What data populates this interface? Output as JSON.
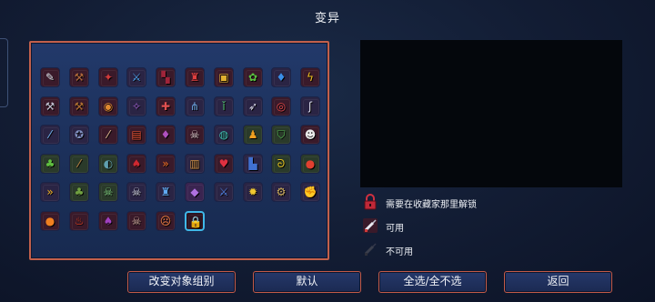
{
  "header": {
    "title": "变异"
  },
  "mutations": {
    "rows": [
      [
        {
          "icon": "syringe-icon",
          "glyph": "✎",
          "fg": "#e6e6f0",
          "bg": "#3a1a2a"
        },
        {
          "icon": "pickaxe-icon",
          "glyph": "⚒",
          "fg": "#b06a3a",
          "bg": "#3a1a2a"
        },
        {
          "icon": "red-dagger-icon",
          "glyph": "✦",
          "fg": "#d03a3a",
          "bg": "#3a1a2a"
        },
        {
          "icon": "blue-swords-icon",
          "glyph": "⚔",
          "fg": "#4aa0e8",
          "bg": "#2a2444"
        },
        {
          "icon": "crimson-rune-icon",
          "glyph": "▚",
          "fg": "#a0243a",
          "bg": "#3a1a2a"
        },
        {
          "icon": "red-potion-icon",
          "glyph": "♜",
          "fg": "#e04040",
          "bg": "#3a1a2a"
        },
        {
          "icon": "treasure-chest-icon",
          "glyph": "▣",
          "fg": "#e0b030",
          "bg": "#3a1a2a"
        },
        {
          "icon": "green-leaf-icon",
          "glyph": "✿",
          "fg": "#5ac040",
          "bg": "#3a1a2a"
        },
        {
          "icon": "blue-bottle-icon",
          "glyph": "♦",
          "fg": "#3a8ee8",
          "bg": "#2a2444"
        },
        {
          "icon": "lightning-icon",
          "glyph": "ϟ",
          "fg": "#f0c020",
          "bg": "#3a1a2a"
        }
      ],
      [
        {
          "icon": "axe-icon",
          "glyph": "⚒",
          "fg": "#c0c0d0",
          "bg": "#3a1a2a"
        },
        {
          "icon": "hammer-icon",
          "glyph": "⚒",
          "fg": "#b07030",
          "bg": "#3a1a2a"
        },
        {
          "icon": "ring-icon",
          "glyph": "◉",
          "fg": "#e08a30",
          "bg": "#3a1a2a"
        },
        {
          "icon": "purple-blade-icon",
          "glyph": "✧",
          "fg": "#a060d0",
          "bg": "#2a2444"
        },
        {
          "icon": "crossed-blades-icon",
          "glyph": "✚",
          "fg": "#e05050",
          "bg": "#3a1a2a"
        },
        {
          "icon": "blue-crossbow-icon",
          "glyph": "⋔",
          "fg": "#70a8e8",
          "bg": "#2a2444"
        },
        {
          "icon": "green-vial-icon",
          "glyph": "ǐ",
          "fg": "#50c070",
          "bg": "#2a2444"
        },
        {
          "icon": "bow-icon",
          "glyph": "➶",
          "fg": "#d8d8e8",
          "bg": "#2a2444"
        },
        {
          "icon": "red-target-icon",
          "glyph": "◎",
          "fg": "#e04848",
          "bg": "#3a1a2a"
        },
        {
          "icon": "hook-icon",
          "glyph": "ʃ",
          "fg": "#e0e0f0",
          "bg": "#2a2444"
        }
      ],
      [
        {
          "icon": "lance-icon",
          "glyph": "⁄",
          "fg": "#70b8f0",
          "bg": "#2a2444"
        },
        {
          "icon": "grenade-icon",
          "glyph": "✪",
          "fg": "#8090c0",
          "bg": "#2a2444"
        },
        {
          "icon": "flail-icon",
          "glyph": "⁄",
          "fg": "#e0c090",
          "bg": "#3a1a2a"
        },
        {
          "icon": "red-chest-icon",
          "glyph": "▤",
          "fg": "#e05030",
          "bg": "#3a1a2a"
        },
        {
          "icon": "violet-gem-icon",
          "glyph": "♦",
          "fg": "#b050c0",
          "bg": "#3a1a2a"
        },
        {
          "icon": "skull-cross-icon",
          "glyph": "☠",
          "fg": "#e0d0d0",
          "bg": "#3a1a2a"
        },
        {
          "icon": "teal-orb-icon",
          "glyph": "◍",
          "fg": "#40c0b0",
          "bg": "#2a2444"
        },
        {
          "icon": "gold-bell-icon",
          "glyph": "♟",
          "fg": "#f0a020",
          "bg": "#2a3a2a"
        },
        {
          "icon": "green-shield-icon",
          "glyph": "⛉",
          "fg": "#50b050",
          "bg": "#2a3a2a"
        },
        {
          "icon": "grin-mask-icon",
          "glyph": "☻",
          "fg": "#e8e8e8",
          "bg": "#3a1a2a"
        }
      ],
      [
        {
          "icon": "acid-flask-icon",
          "glyph": "♣",
          "fg": "#60c040",
          "bg": "#2a3a2a"
        },
        {
          "icon": "spear-icon",
          "glyph": "⁄",
          "fg": "#c08040",
          "bg": "#2a3a2a"
        },
        {
          "icon": "shell-icon",
          "glyph": "◐",
          "fg": "#60a0b0",
          "bg": "#2a3a2a"
        },
        {
          "icon": "blood-drop-icon",
          "glyph": "♠",
          "fg": "#d02830",
          "bg": "#3a1a2a"
        },
        {
          "icon": "dash-arrows-icon",
          "glyph": "»",
          "fg": "#f07020",
          "bg": "#3a1a2a"
        },
        {
          "icon": "barrel-icon",
          "glyph": "▥",
          "fg": "#d09040",
          "bg": "#2a2444"
        },
        {
          "icon": "heart-arrow-icon",
          "glyph": "♥",
          "fg": "#e03040",
          "bg": "#3a1a2a"
        },
        {
          "icon": "blue-gauntlet-icon",
          "glyph": "▙",
          "fg": "#4070d0",
          "bg": "#2a2444"
        },
        {
          "icon": "coil-icon",
          "glyph": "ᘐ",
          "fg": "#e0c020",
          "bg": "#2a3a2a"
        },
        {
          "icon": "strawberry-icon",
          "glyph": "●",
          "fg": "#e04030",
          "bg": "#2a3a2a"
        }
      ],
      [
        {
          "icon": "double-arrow-icon",
          "glyph": "»",
          "fg": "#f0b020",
          "bg": "#2a2444"
        },
        {
          "icon": "green-claw-icon",
          "glyph": "♣",
          "fg": "#70a040",
          "bg": "#2a3a2a"
        },
        {
          "icon": "green-skull-icon",
          "glyph": "☠",
          "fg": "#80d080",
          "bg": "#2a3a2a"
        },
        {
          "icon": "bone-skull-icon",
          "glyph": "☠",
          "fg": "#d8dce8",
          "bg": "#2a2444"
        },
        {
          "icon": "blue-castle-icon",
          "glyph": "♜",
          "fg": "#60a8f0",
          "bg": "#2a2444"
        },
        {
          "icon": "purple-crystal-icon",
          "glyph": "◆",
          "fg": "#b070e0",
          "bg": "#3a2450"
        },
        {
          "icon": "blue-sword-icon",
          "glyph": "⚔",
          "fg": "#5080e0",
          "bg": "#2a2444"
        },
        {
          "icon": "sun-flare-icon",
          "glyph": "✹",
          "fg": "#f0c830",
          "bg": "#2a2444"
        },
        {
          "icon": "gear-icon",
          "glyph": "⚙",
          "fg": "#d0b060",
          "bg": "#2a2444"
        },
        {
          "icon": "golden-fist-icon",
          "glyph": "✊",
          "fg": "#f0c020",
          "bg": "#2a2444"
        }
      ],
      [
        {
          "icon": "fire-orb-icon",
          "glyph": "●",
          "fg": "#f08020",
          "bg": "#3a1a2a"
        },
        {
          "icon": "flame-blade-icon",
          "glyph": "♨",
          "fg": "#e04020",
          "bg": "#3a1a2a"
        },
        {
          "icon": "purple-potion-icon",
          "glyph": "♠",
          "fg": "#a040c0",
          "bg": "#3a1a2a"
        },
        {
          "icon": "bronze-skull-icon",
          "glyph": "☠",
          "fg": "#d0b0a0",
          "bg": "#3a1a2a"
        },
        {
          "icon": "orange-mask-icon",
          "glyph": "☹",
          "fg": "#f08040",
          "bg": "#3a1a2a"
        },
        {
          "icon": "padlock-icon",
          "glyph": "🔒",
          "fg": "#e03040",
          "bg": "#2e1420",
          "selected": true
        }
      ]
    ]
  },
  "legend": {
    "locked": "需要在收藏家那里解锁",
    "available": "可用",
    "unavailable": "不可用"
  },
  "buttons": {
    "change_group": "改变对象组别",
    "default": "默认",
    "select_all": "全选/全不选",
    "back": "返回"
  }
}
